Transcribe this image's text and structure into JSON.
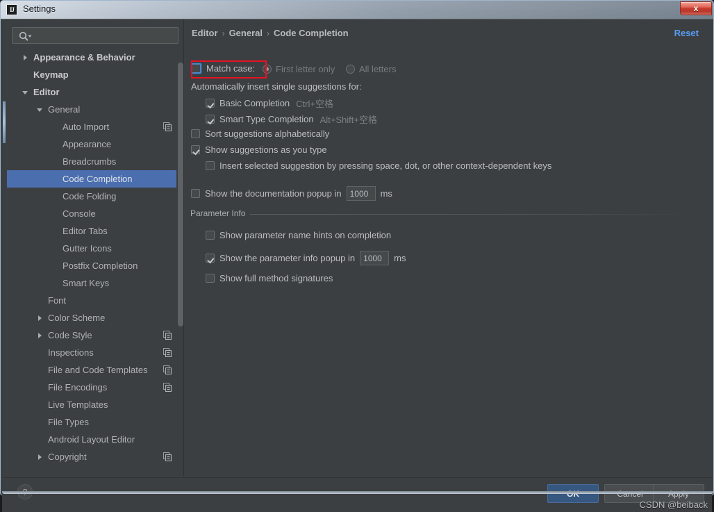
{
  "window": {
    "title": "Settings",
    "app_icon": "intellij-idea-icon",
    "close_label": "x"
  },
  "search": {
    "value": "",
    "placeholder": "",
    "icon": "search-icon-with-dropdown"
  },
  "sidebar": {
    "items": [
      {
        "label": "Appearance & Behavior",
        "indent": 0,
        "arrow": "collapsed",
        "bold": true,
        "selected": false,
        "icon": null
      },
      {
        "label": "Keymap",
        "indent": 0,
        "arrow": "none",
        "bold": true,
        "selected": false,
        "icon": null
      },
      {
        "label": "Editor",
        "indent": 0,
        "arrow": "expanded",
        "bold": true,
        "selected": false,
        "icon": null
      },
      {
        "label": "General",
        "indent": 1,
        "arrow": "expanded",
        "bold": false,
        "selected": false,
        "icon": null
      },
      {
        "label": "Auto Import",
        "indent": 2,
        "arrow": "none",
        "bold": false,
        "selected": false,
        "icon": "copy-icon"
      },
      {
        "label": "Appearance",
        "indent": 2,
        "arrow": "none",
        "bold": false,
        "selected": false,
        "icon": null
      },
      {
        "label": "Breadcrumbs",
        "indent": 2,
        "arrow": "none",
        "bold": false,
        "selected": false,
        "icon": null
      },
      {
        "label": "Code Completion",
        "indent": 2,
        "arrow": "none",
        "bold": false,
        "selected": true,
        "icon": null
      },
      {
        "label": "Code Folding",
        "indent": 2,
        "arrow": "none",
        "bold": false,
        "selected": false,
        "icon": null
      },
      {
        "label": "Console",
        "indent": 2,
        "arrow": "none",
        "bold": false,
        "selected": false,
        "icon": null
      },
      {
        "label": "Editor Tabs",
        "indent": 2,
        "arrow": "none",
        "bold": false,
        "selected": false,
        "icon": null
      },
      {
        "label": "Gutter Icons",
        "indent": 2,
        "arrow": "none",
        "bold": false,
        "selected": false,
        "icon": null
      },
      {
        "label": "Postfix Completion",
        "indent": 2,
        "arrow": "none",
        "bold": false,
        "selected": false,
        "icon": null
      },
      {
        "label": "Smart Keys",
        "indent": 2,
        "arrow": "none",
        "bold": false,
        "selected": false,
        "icon": null
      },
      {
        "label": "Font",
        "indent": 1,
        "arrow": "none",
        "bold": false,
        "selected": false,
        "icon": null
      },
      {
        "label": "Color Scheme",
        "indent": 1,
        "arrow": "collapsed",
        "bold": false,
        "selected": false,
        "icon": null
      },
      {
        "label": "Code Style",
        "indent": 1,
        "arrow": "collapsed",
        "bold": false,
        "selected": false,
        "icon": "copy-icon"
      },
      {
        "label": "Inspections",
        "indent": 1,
        "arrow": "none",
        "bold": false,
        "selected": false,
        "icon": "copy-icon"
      },
      {
        "label": "File and Code Templates",
        "indent": 1,
        "arrow": "none",
        "bold": false,
        "selected": false,
        "icon": "copy-icon"
      },
      {
        "label": "File Encodings",
        "indent": 1,
        "arrow": "none",
        "bold": false,
        "selected": false,
        "icon": "copy-icon"
      },
      {
        "label": "Live Templates",
        "indent": 1,
        "arrow": "none",
        "bold": false,
        "selected": false,
        "icon": null
      },
      {
        "label": "File Types",
        "indent": 1,
        "arrow": "none",
        "bold": false,
        "selected": false,
        "icon": null
      },
      {
        "label": "Android Layout Editor",
        "indent": 1,
        "arrow": "none",
        "bold": false,
        "selected": false,
        "icon": null
      },
      {
        "label": "Copyright",
        "indent": 1,
        "arrow": "collapsed",
        "bold": false,
        "selected": false,
        "icon": "copy-icon"
      }
    ]
  },
  "main": {
    "breadcrumb": [
      "Editor",
      "General",
      "Code Completion"
    ],
    "breadcrumb_separator": "›",
    "reset_label": "Reset",
    "match_case": {
      "label": "Match case:",
      "checked": false,
      "focused": true,
      "options": [
        {
          "label": "First letter only",
          "selected": true,
          "disabled": true
        },
        {
          "label": "All letters",
          "selected": false,
          "disabled": true
        }
      ]
    },
    "auto_insert_heading": "Automatically insert single suggestions for:",
    "auto_insert_items": [
      {
        "label": "Basic Completion",
        "checked": true,
        "shortcut": "Ctrl+空格"
      },
      {
        "label": "Smart Type Completion",
        "checked": true,
        "shortcut": "Alt+Shift+空格"
      }
    ],
    "sort_alphabetically": {
      "label": "Sort suggestions alphabetically",
      "checked": false
    },
    "show_as_you_type": {
      "label": "Show suggestions as you type",
      "checked": true
    },
    "insert_on_keys": {
      "label": "Insert selected suggestion by pressing space, dot, or other context-dependent keys",
      "checked": false
    },
    "doc_popup": {
      "label_before": "Show the documentation popup in",
      "value": "1000",
      "unit": "ms",
      "checked": false
    },
    "parameter_info": {
      "group_title": "Parameter Info",
      "name_hints": {
        "label": "Show parameter name hints on completion",
        "checked": false
      },
      "info_popup": {
        "label_before": "Show the parameter info popup in",
        "value": "1000",
        "unit": "ms",
        "checked": true
      },
      "full_signatures": {
        "label": "Show full method signatures",
        "checked": false
      }
    }
  },
  "bottom": {
    "help_label": "?",
    "ok_label": "OK",
    "cancel_label": "Cancel",
    "apply_label": "Apply",
    "watermark": "CSDN @beiback"
  },
  "colors": {
    "accent_selection": "#4b6eaf",
    "link": "#589df6",
    "ok_button": "#365880",
    "annotation": "#e81123",
    "panel_bg": "#3c3f41"
  }
}
